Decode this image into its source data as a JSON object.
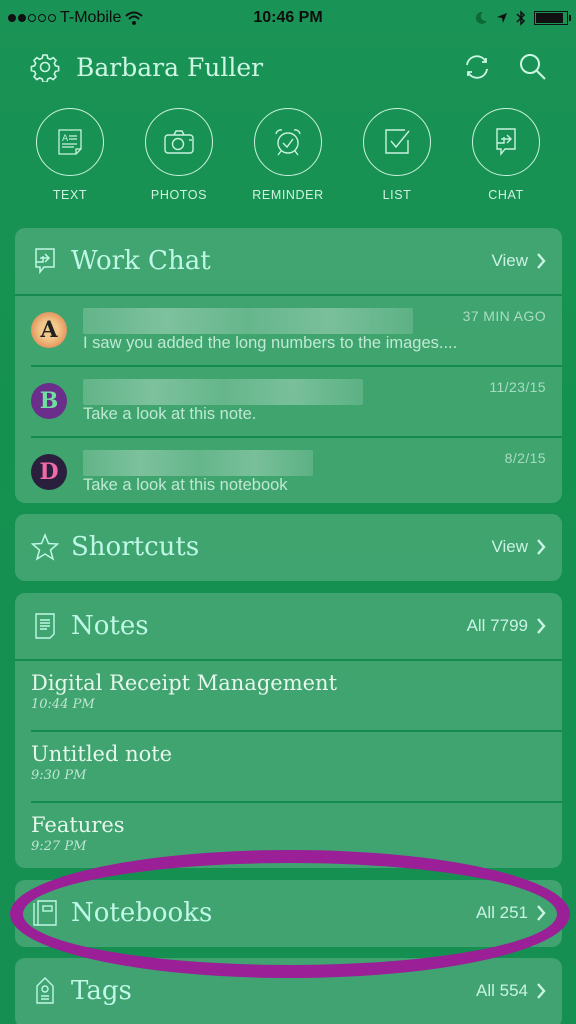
{
  "status_bar": {
    "carrier": "T-Mobile",
    "signal_bars_filled": 2,
    "signal_bars_total": 5,
    "time": "10:46 PM",
    "battery_level": 0.9
  },
  "header": {
    "title": "Barbara Fuller",
    "icons": [
      "gear-icon",
      "sync-icon",
      "search-icon"
    ]
  },
  "quick_actions": [
    {
      "label": "TEXT",
      "icon": "text-note-icon"
    },
    {
      "label": "PHOTOS",
      "icon": "camera-icon"
    },
    {
      "label": "REMINDER",
      "icon": "alarm-clock-icon"
    },
    {
      "label": "LIST",
      "icon": "checkbox-icon"
    },
    {
      "label": "CHAT",
      "icon": "chat-icon"
    }
  ],
  "work_chat": {
    "title": "Work Chat",
    "link": "View",
    "items": [
      {
        "avatar_letter": "A",
        "time": "37 MIN AGO",
        "preview": "I saw you added the long numbers to the images...."
      },
      {
        "avatar_letter": "B",
        "time": "11/23/15",
        "preview": "Take a look at this note."
      },
      {
        "avatar_letter": "D",
        "time": "8/2/15",
        "preview": "Take a look at this notebook"
      }
    ]
  },
  "shortcuts": {
    "title": "Shortcuts",
    "link": "View"
  },
  "notes": {
    "title": "Notes",
    "link": "All 7799",
    "items": [
      {
        "title": "Digital Receipt Management",
        "time": "10:44 PM"
      },
      {
        "title": "Untitled note",
        "time": "9:30 PM"
      },
      {
        "title": "Features",
        "time": "9:27 PM"
      }
    ]
  },
  "notebooks": {
    "title": "Notebooks",
    "link": "All 251"
  },
  "tags": {
    "title": "Tags",
    "link": "All 554"
  },
  "colors": {
    "background": "#15914f",
    "card": "rgba(255,255,255,0.18)",
    "accent_text": "#bff8e6",
    "highlight_annotation": "#9b1f96"
  }
}
